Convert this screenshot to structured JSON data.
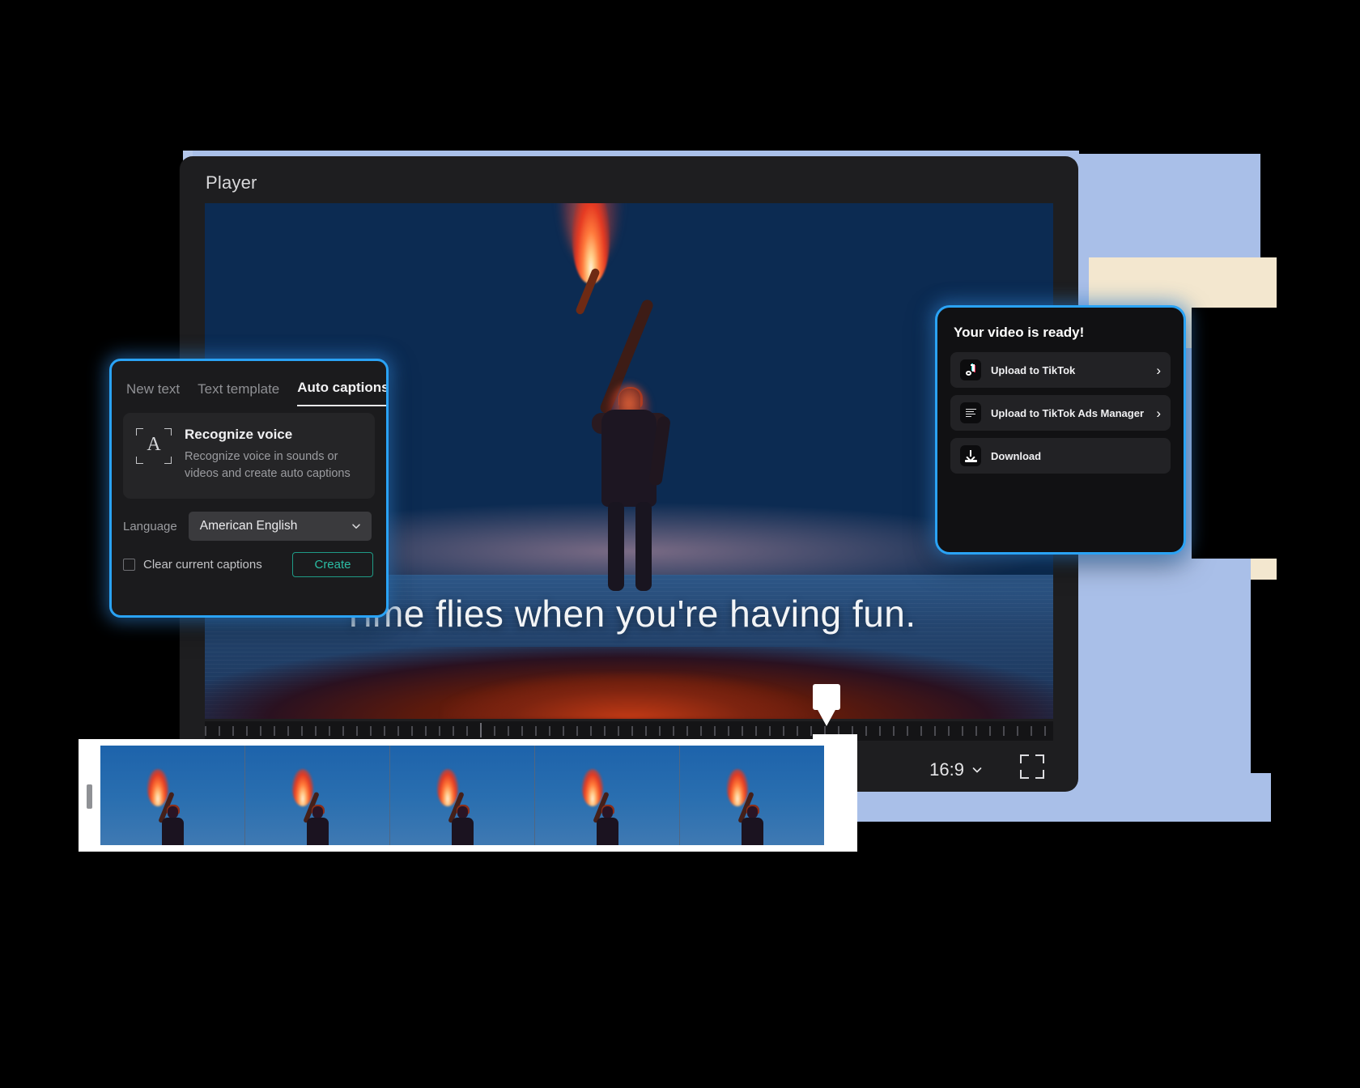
{
  "theme": {
    "accent_blue": "#2aa3f5",
    "panel_bg": "#1b1b1d",
    "export_bg": "#111113",
    "create_green": "#2bbda4",
    "bg_lavender": "#a9bfe8",
    "bg_cream": "#f3e7cf",
    "bg_periwinkle": "#b4c7ea"
  },
  "player": {
    "title": "Player",
    "caption": "Time flies when you're having fun.",
    "aspect_ratio": "16:9",
    "aspect_ratio_icon": "chevron-down-icon",
    "fullscreen_icon": "fullscreen-icon"
  },
  "text_panel": {
    "tabs": [
      {
        "label": "New text",
        "active": false
      },
      {
        "label": "Text template",
        "active": false
      },
      {
        "label": "Auto captions",
        "active": true
      }
    ],
    "collapse_icon": "«",
    "recognize": {
      "icon": "recognize-voice-icon",
      "glyph": "A",
      "title": "Recognize voice",
      "description": "Recognize voice in sounds or videos and create auto captions"
    },
    "language": {
      "label": "Language",
      "value": "American English",
      "chevron_icon": "chevron-down-icon"
    },
    "clear_captions": {
      "label": "Clear current captions",
      "checked": false
    },
    "create_button": "Create"
  },
  "export_panel": {
    "title": "Your video is ready!",
    "rows": [
      {
        "label": "Upload to TikTok",
        "icon": "tiktok-icon",
        "chevron": "›"
      },
      {
        "label": "Upload to TikTok Ads Manager",
        "icon": "tiktok-ads-icon",
        "chevron": "›"
      },
      {
        "label": "Download",
        "icon": "download-icon",
        "chevron": ""
      }
    ]
  },
  "timeline": {
    "frame_count": 5,
    "left_handle": "trim-handle-left",
    "right_handle": "trim-handle-right",
    "playhead": "playhead-marker"
  }
}
